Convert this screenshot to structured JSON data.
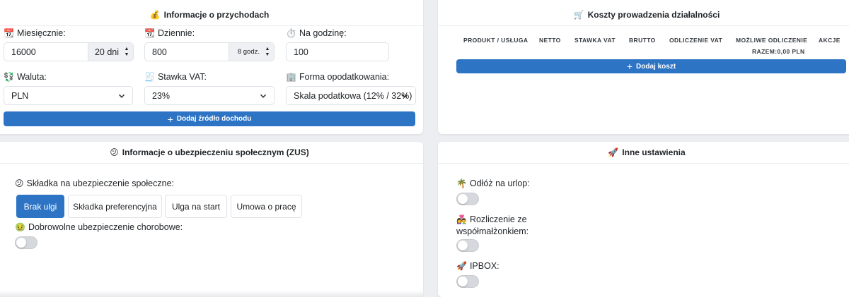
{
  "income": {
    "title": "Informacje o przychodach",
    "title_icon": "💰",
    "monthly": {
      "icon": "📆",
      "label": "Miesięcznie:",
      "value": "16000",
      "addon": "20 dni"
    },
    "daily": {
      "icon": "📆",
      "label": "Dziennie:",
      "value": "800",
      "addon": "8 godz."
    },
    "hourly": {
      "icon": "⏱️",
      "label": "Na godzinę:",
      "value": "100"
    },
    "currency": {
      "icon": "💱",
      "label": "Waluta:",
      "value": "PLN"
    },
    "vat": {
      "icon": "🧾",
      "label": "Stawka VAT:",
      "value": "23%"
    },
    "tax_form": {
      "icon": "🏢",
      "label": "Forma opodatkowania:",
      "value": "Skala podatkowa (12% / 32%)"
    },
    "add_source": "Dodaj źródło dochodu"
  },
  "costs": {
    "title": "Koszty prowadzenia działalności",
    "title_icon": "🛒",
    "columns": [
      "PRODUKT / USŁUGA",
      "NETTO",
      "STAWKA VAT",
      "BRUTTO",
      "ODLICZENIE VAT",
      "MOŻLIWE ODLICZENIE",
      "AKCJE"
    ],
    "total": "RAZEM:0,00 PLN",
    "add_cost": "Dodaj koszt"
  },
  "zus": {
    "title": "Informacje o ubezpieczeniu społecznym (ZUS)",
    "title_icon": "😕",
    "contribution": {
      "icon": "😕",
      "label": "Składka na ubezpieczenie społeczne:"
    },
    "options": [
      "Brak ulgi",
      "Składka preferencyjna",
      "Ulga na start",
      "Umowa o pracę"
    ],
    "active_option": "Brak ulgi",
    "sickness": {
      "icon": "🤢",
      "label": "Dobrowolne ubezpieczenie chorobowe:",
      "enabled": false
    }
  },
  "other": {
    "title": "Inne ustawienia",
    "title_icon": "🚀",
    "vacation": {
      "icon": "🌴",
      "label": "Odłóż na urlop:",
      "enabled": false
    },
    "spouse": {
      "icon": "👩‍❤️‍👨",
      "label_line1": "Rozliczenie ze",
      "label_line2": "współmałżonkiem:",
      "enabled": false
    },
    "ipbox": {
      "icon": "🚀",
      "label": "IPBOX:",
      "enabled": false
    }
  },
  "colors": {
    "primary": "#2d74c4",
    "background": "#eceef1",
    "toggle_off": "#d5d8dc"
  }
}
